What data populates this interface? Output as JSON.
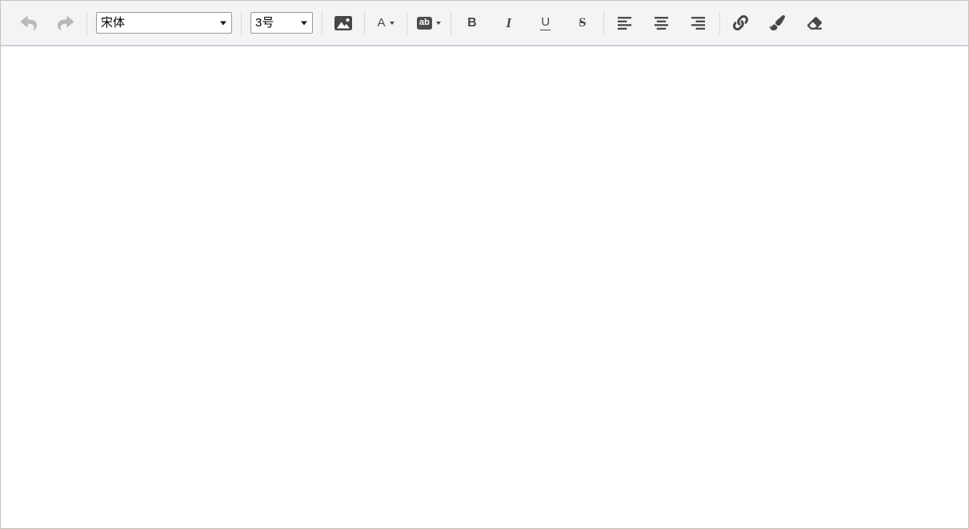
{
  "toolbar": {
    "undo": {
      "icon": "undo-icon",
      "disabled": true
    },
    "redo": {
      "icon": "redo-icon",
      "disabled": true
    },
    "font_family": {
      "value": "宋体"
    },
    "font_size": {
      "value": "3号"
    },
    "insert_image": {
      "icon": "image-icon"
    },
    "font_color": {
      "label": "A",
      "icon": "chevron-down-icon"
    },
    "highlight": {
      "label": "ab",
      "icon": "chevron-down-icon"
    },
    "bold": {
      "label": "B"
    },
    "italic": {
      "label": "I"
    },
    "underline": {
      "label": "U"
    },
    "strikethrough": {
      "label": "S"
    },
    "align_left": {
      "icon": "align-left-icon"
    },
    "align_center": {
      "icon": "align-center-icon"
    },
    "align_right": {
      "icon": "align-right-icon"
    },
    "link": {
      "icon": "link-icon"
    },
    "format_brush": {
      "icon": "brush-icon"
    },
    "eraser": {
      "icon": "eraser-icon"
    }
  },
  "content": {
    "text": ""
  },
  "colors": {
    "toolbar_bg": "#f4f4f5",
    "toolbar_border_bottom": "#ccd3db",
    "outer_border": "#c2c2c2",
    "icon": "#474747",
    "icon_disabled": "#b9b9b9",
    "separator": "#d9d9d9",
    "select_border": "#9a9a9a",
    "highlight_box_bg": "#4d4d4d"
  }
}
